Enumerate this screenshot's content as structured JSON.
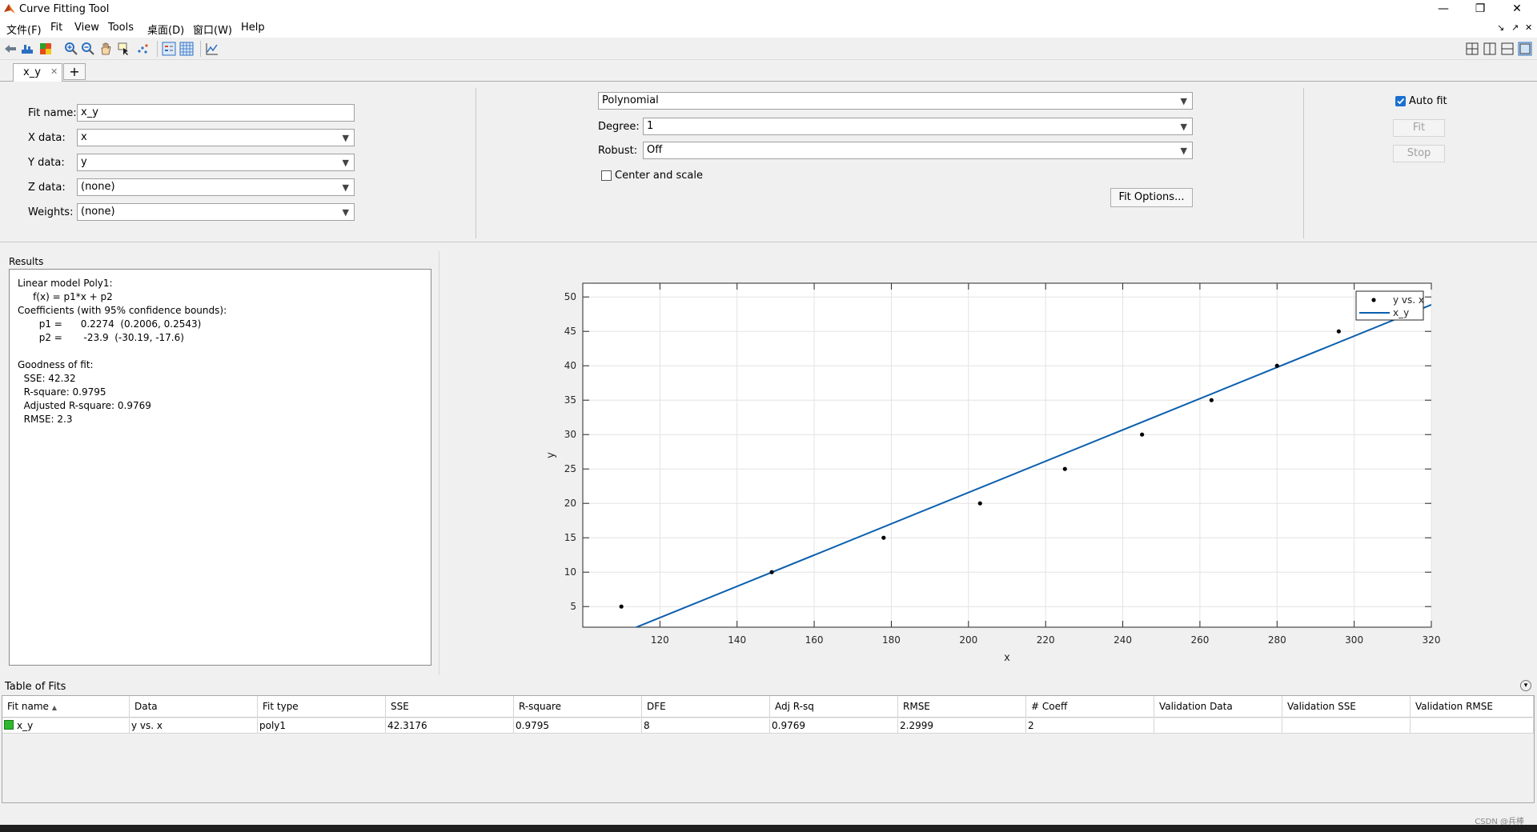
{
  "window": {
    "title": "Curve Fitting Tool",
    "minimize": "—",
    "restore": "❐",
    "close": "✕"
  },
  "menu": [
    "文件(F)",
    "Fit",
    "View",
    "Tools",
    "桌面(D)",
    "窗口(W)",
    "Help"
  ],
  "tabs": {
    "active": "x_y",
    "add": "+"
  },
  "fit_config": {
    "fit_name_label": "Fit name:",
    "fit_name": "x_y",
    "x_label": "X data:",
    "x_value": "x",
    "y_label": "Y data:",
    "y_value": "y",
    "z_label": "Z data:",
    "z_value": "(none)",
    "weights_label": "Weights:",
    "weights_value": "(none)"
  },
  "model": {
    "type": "Polynomial",
    "degree_label": "Degree:",
    "degree": "1",
    "robust_label": "Robust:",
    "robust": "Off",
    "center_scale_label": "Center and scale",
    "center_scale_checked": false,
    "fit_options": "Fit Options..."
  },
  "controls": {
    "auto_fit_label": "Auto fit",
    "auto_fit_checked": true,
    "fit": "Fit",
    "stop": "Stop"
  },
  "results": {
    "title": "Results",
    "lines": [
      "Linear model Poly1:",
      "     f(x) = p1*x + p2",
      "Coefficients (with 95% confidence bounds):",
      "       p1 =      0.2274  (0.2006, 0.2543)",
      "       p2 =       -23.9  (-30.19, -17.6)",
      "",
      "Goodness of fit:",
      "  SSE: 42.32",
      "  R-square: 0.9795",
      "  Adjusted R-square: 0.9769",
      "  RMSE: 2.3"
    ]
  },
  "chart_data": {
    "type": "scatter",
    "xlabel": "x",
    "ylabel": "y",
    "xlim": [
      100,
      320
    ],
    "ylim": [
      2,
      52
    ],
    "xticks": [
      120,
      140,
      160,
      180,
      200,
      220,
      240,
      260,
      280,
      300,
      320
    ],
    "yticks": [
      5,
      10,
      15,
      20,
      25,
      30,
      35,
      40,
      45,
      50
    ],
    "grid": true,
    "legend_position": "top-right",
    "series": [
      {
        "name": "y vs. x",
        "kind": "points",
        "x": [
          110,
          149,
          178,
          203,
          225,
          245,
          263,
          280,
          296
        ],
        "y": [
          5,
          10,
          15,
          20,
          25,
          30,
          35,
          40,
          45
        ]
      },
      {
        "name": "x_y",
        "kind": "line",
        "slope": 0.2274,
        "intercept": -23.9
      }
    ],
    "colors": {
      "points": "#000000",
      "line": "#0b5fae"
    }
  },
  "table_of_fits": {
    "title": "Table of Fits",
    "columns": [
      "Fit name",
      "Data",
      "Fit type",
      "SSE",
      "R-square",
      "DFE",
      "Adj R-sq",
      "RMSE",
      "# Coeff",
      "Validation Data",
      "Validation SSE",
      "Validation RMSE"
    ],
    "rows": [
      [
        "x_y",
        "y vs. x",
        "poly1",
        "42.3176",
        "0.9795",
        "8",
        "0.9769",
        "2.2999",
        "2",
        "",
        "",
        ""
      ]
    ],
    "row_color": "#2db82d"
  },
  "watermark": "CSDN @兵棒"
}
